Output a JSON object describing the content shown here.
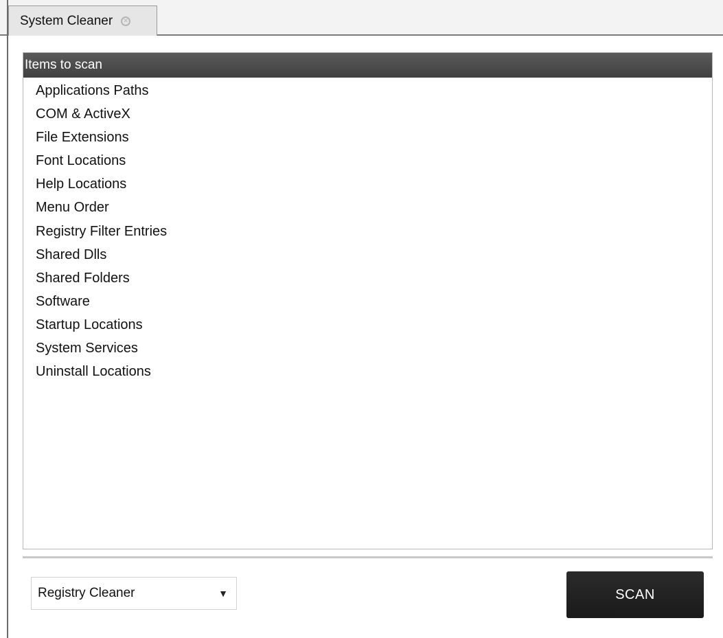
{
  "tab": {
    "title": "System Cleaner",
    "close_icon": "close-circle-icon"
  },
  "list": {
    "header": "Items to scan",
    "items": [
      "Applications Paths",
      "COM & ActiveX",
      "File Extensions",
      "Font Locations",
      "Help Locations",
      "Menu Order",
      "Registry Filter Entries",
      "Shared Dlls",
      "Shared Folders",
      "Software",
      "Startup Locations",
      "System Services",
      "Uninstall Locations"
    ]
  },
  "footer": {
    "cleaner_select": {
      "selected": "Registry Cleaner",
      "arrow_icon": "triangle-down-icon"
    },
    "scan_label": "SCAN"
  },
  "colors": {
    "header_bg": "#4a4a4a",
    "button_bg": "#222222"
  }
}
